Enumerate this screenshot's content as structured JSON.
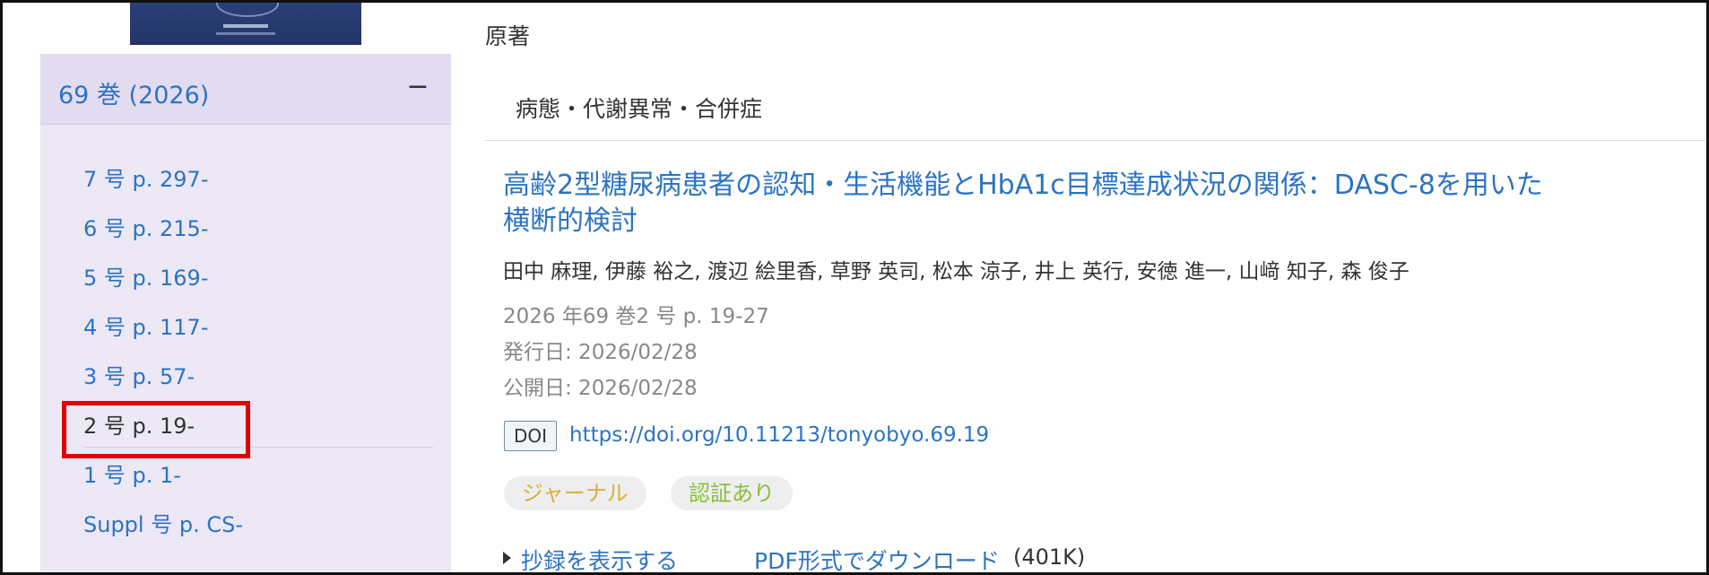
{
  "sidebar": {
    "volume_title": "69 巻 (2026)",
    "collapse_symbol": "−",
    "issues": [
      {
        "label": "7 号 p. 297-"
      },
      {
        "label": "6 号 p. 215-"
      },
      {
        "label": "5 号 p. 169-"
      },
      {
        "label": "4 号 p. 117-"
      },
      {
        "label": "3 号 p. 57-"
      },
      {
        "label": "2 号 p. 19-",
        "current": true
      },
      {
        "label": "1 号 p. 1-"
      },
      {
        "label": "Suppl 号 p. CS-"
      }
    ]
  },
  "main": {
    "genre": "原著",
    "category": "病態・代謝異常・合併症",
    "article": {
      "title": "高齢2型糖尿病患者の認知・生活機能とHbA1c目標達成状況の関係：DASC-8を用いた横断的検討",
      "authors": "田中 麻理, 伊藤 裕之, 渡辺 絵里香, 草野 英司, 松本 涼子, 井上 英行, 安徳 進一, 山﨑 知子, 森 俊子",
      "citation": "2026 年69 巻2 号 p. 19-27",
      "published": "発行日: 2026/02/28",
      "released": "公開日: 2026/02/28",
      "doi_label": "DOI",
      "doi_url": "https://doi.org/10.11213/tonyobyo.69.19",
      "tags": [
        "ジャーナル",
        "認証あり"
      ],
      "abstract_link": "抄録を表示する",
      "pdf_link": "PDF形式でダウンロード",
      "pdf_size": "(401K)"
    }
  },
  "colors": {
    "link": "#2c73c4",
    "sidebar_bg": "#ede8f5",
    "sidebar_header_bg": "#e3dcf0",
    "highlight": "#e00000",
    "tag_journal": "#d9b13a",
    "tag_verified": "#8abf3a"
  }
}
